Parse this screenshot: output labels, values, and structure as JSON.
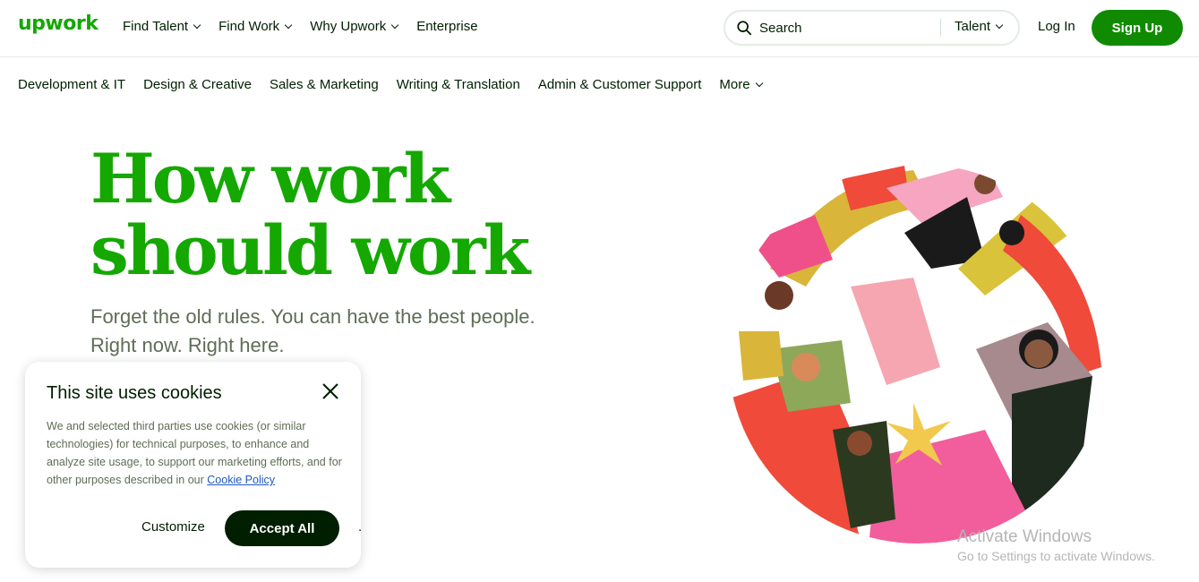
{
  "brand": {
    "logo": "upwork",
    "accent": "#14a800",
    "button_green": "#108a00",
    "dark": "#001e00"
  },
  "header": {
    "nav": [
      {
        "label": "Find Talent",
        "dropdown": true
      },
      {
        "label": "Find Work",
        "dropdown": true
      },
      {
        "label": "Why Upwork",
        "dropdown": true
      },
      {
        "label": "Enterprise",
        "dropdown": false
      }
    ],
    "search": {
      "placeholder": "Search",
      "scope": "Talent",
      "icon": "search-icon"
    },
    "login_label": "Log In",
    "signup_label": "Sign Up"
  },
  "categories": [
    {
      "label": "Development & IT"
    },
    {
      "label": "Design & Creative"
    },
    {
      "label": "Sales & Marketing"
    },
    {
      "label": "Writing & Translation"
    },
    {
      "label": "Admin & Customer Support"
    },
    {
      "label": "More",
      "dropdown": true
    }
  ],
  "hero": {
    "title_line1": "How work",
    "title_line2": "should work",
    "subtitle_line1": "Forget the old rules. You can have the best people.",
    "subtitle_line2": "Right now. Right here."
  },
  "cookie_dialog": {
    "title": "This site uses cookies",
    "body": "We and selected third parties use cookies (or similar technologies) for technical purposes, to enhance and analyze site usage, to support our marketing efforts, and for other purposes described in our ",
    "link_label": "Cookie Policy",
    "customize_label": "Customize",
    "accept_label": "Accept All",
    "stray": "."
  },
  "watermark": {
    "line1": "Activate Windows",
    "line2": "Go to Settings to activate Windows."
  }
}
